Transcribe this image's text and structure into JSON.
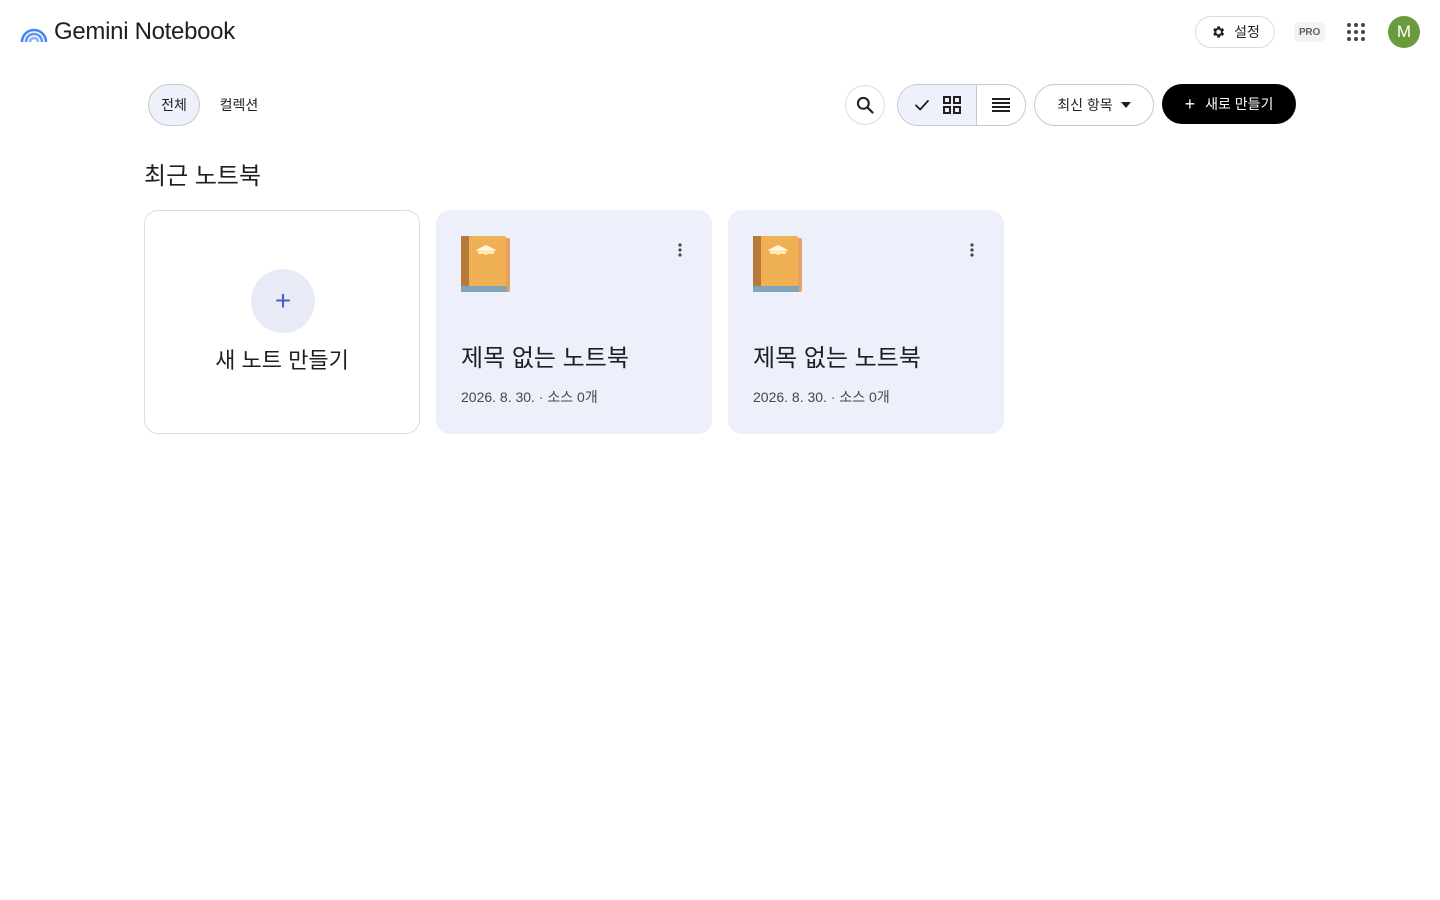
{
  "app": {
    "name": "Gemini Notebook",
    "settings_label": "설정",
    "pro_badge": "PRO",
    "avatar_initial": "M",
    "logo_icon": "rainbow-arc-icon",
    "accent_color": "#4a5ad6"
  },
  "toolbar": {
    "filters": [
      {
        "label": "전체",
        "selected": true
      },
      {
        "label": "컬렉션",
        "selected": false
      }
    ],
    "search_icon": "search-icon",
    "view_mode": "grid",
    "sort_label": "최신 항목",
    "create_label": "새로 만들기"
  },
  "section": {
    "title": "최근 노트북"
  },
  "new_card": {
    "label": "새 노트 만들기"
  },
  "notebooks": [
    {
      "title": "제목 없는 노트북",
      "meta": "2026. 8. 30. · 소스 0개",
      "icon": "notebook-emoji-icon"
    },
    {
      "title": "제목 없는 노트북",
      "meta": "2026. 8. 30. · 소스 0개",
      "icon": "notebook-emoji-icon"
    }
  ]
}
